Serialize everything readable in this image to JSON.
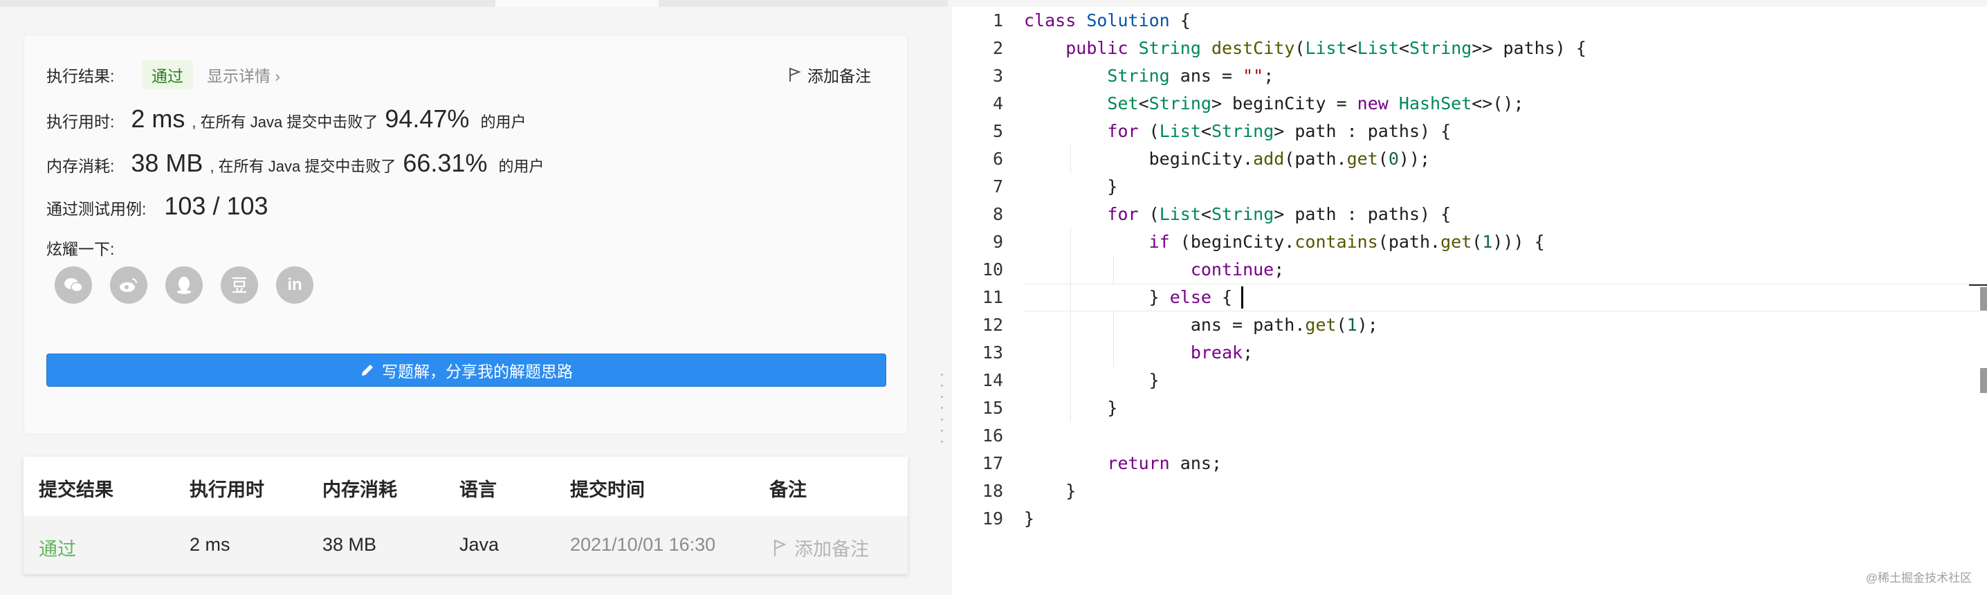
{
  "result": {
    "status_label": "执行结果:",
    "status": "通过",
    "details_link": "显示详情 ›",
    "add_note": "添加备注",
    "runtime_label": "执行用时:",
    "runtime_value": "2 ms",
    "runtime_text": ", 在所有 Java 提交中击败了",
    "runtime_percent": "94.47%",
    "runtime_suffix": "的用户",
    "memory_label": "内存消耗:",
    "memory_value": "38 MB",
    "memory_text": ", 在所有 Java 提交中击败了",
    "memory_percent": "66.31%",
    "memory_suffix": "的用户",
    "tests_label": "通过测试用例:",
    "tests_value": "103 / 103",
    "share_label": "炫耀一下:",
    "social_icons": [
      "wechat-icon",
      "weibo-icon",
      "qq-icon",
      "douban-icon",
      "linkedin-icon"
    ],
    "write_solution": "写题解，分享我的解题思路"
  },
  "submissions": {
    "headers": [
      "提交结果",
      "执行用时",
      "内存消耗",
      "语言",
      "提交时间",
      "备注"
    ],
    "row": {
      "result": "通过",
      "runtime": "2 ms",
      "memory": "38 MB",
      "language": "Java",
      "time": "2021/10/01 16:30",
      "note": "添加备注"
    }
  },
  "editor": {
    "line_numbers": [
      "1",
      "2",
      "3",
      "4",
      "5",
      "6",
      "7",
      "8",
      "9",
      "10",
      "11",
      "12",
      "13",
      "14",
      "15",
      "16",
      "17",
      "18",
      "19"
    ],
    "current_line": "11",
    "lines": [
      "class Solution {",
      "    public String destCity(List<List<String>> paths) {",
      "        String ans = \"\";",
      "        Set<String> beginCity = new HashSet<>();",
      "        for (List<String> path : paths) {",
      "            beginCity.add(path.get(0));",
      "        }",
      "        for (List<String> path : paths) {",
      "            if (beginCity.contains(path.get(1))) {",
      "                continue;",
      "            } else {",
      "                ans = path.get(1);",
      "                break;",
      "            }",
      "        }",
      "",
      "        return ans;",
      "    }",
      "}"
    ]
  },
  "watermark": "@稀土掘金技术社区",
  "colors": {
    "accent": "#2d8cf0",
    "pass_green": "#5cb85c",
    "keyword": "#770088",
    "type": "#008855"
  }
}
